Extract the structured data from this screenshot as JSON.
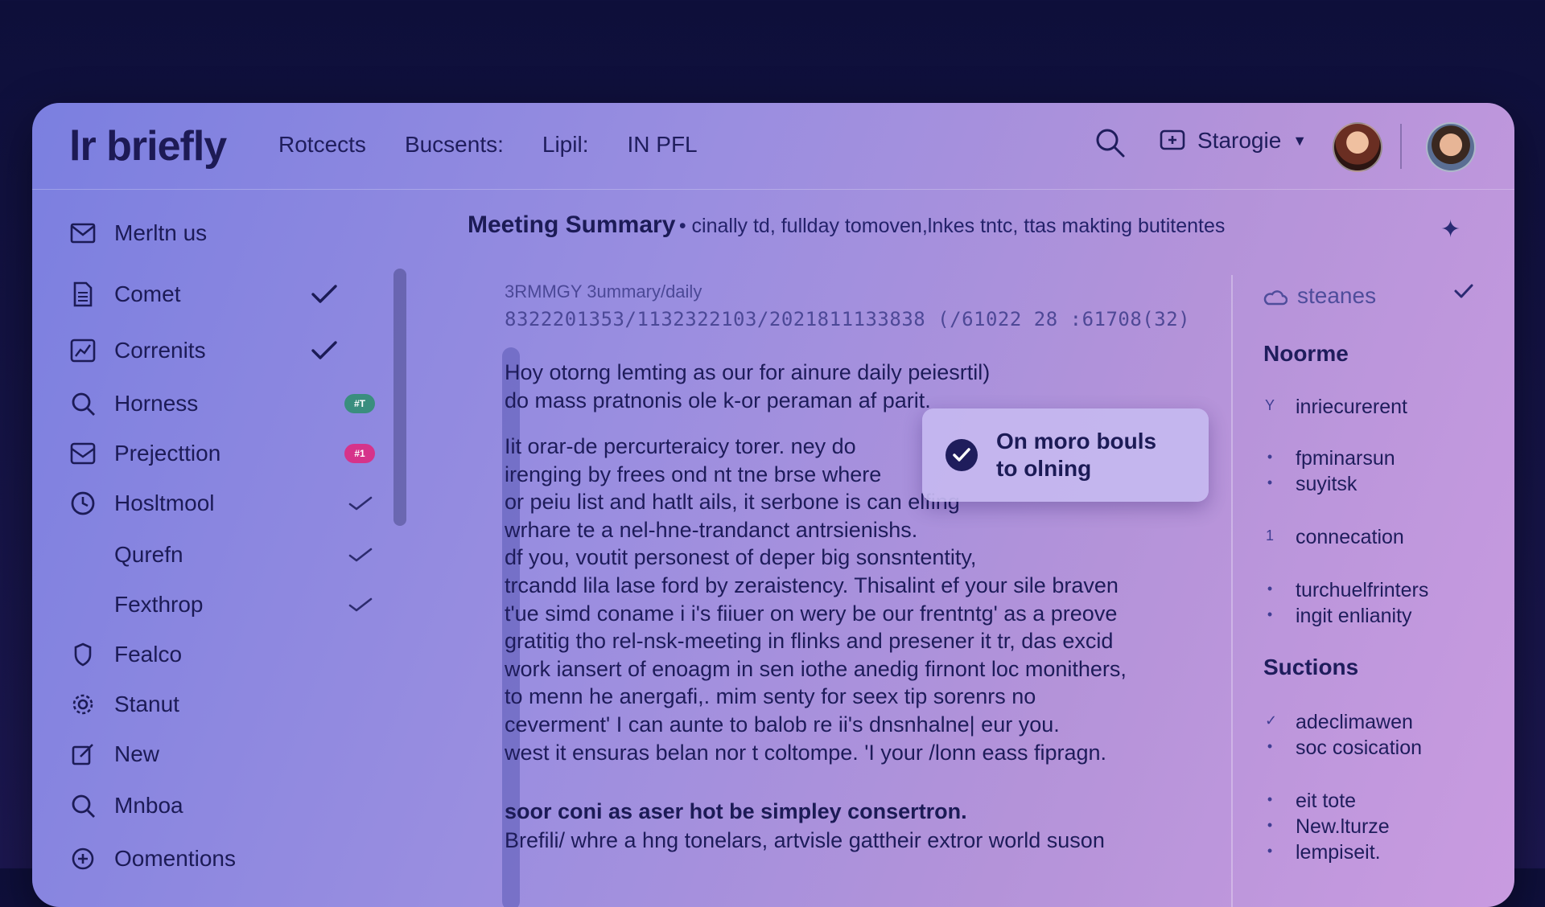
{
  "app": {
    "logo": "lr briefly",
    "nav": [
      "Rotcects",
      "Bucsents:",
      "Lipil:",
      "IN PFL"
    ],
    "workspace_label": "Starogie",
    "icons": {
      "search": "search-icon",
      "workspace": "workspace-icon",
      "caret": "caret-down-icon"
    }
  },
  "sidebar": {
    "items": [
      {
        "label": "Merltn us",
        "icon": "mail-icon",
        "right": ""
      },
      {
        "label": "Comet",
        "icon": "document-icon",
        "right": "check"
      },
      {
        "label": "Correnits",
        "icon": "chart-icon",
        "right": "check"
      },
      {
        "label": "Horness",
        "icon": "search-refresh-icon",
        "right": "badge",
        "badge": "#T",
        "badge_color": "#3a8e7e"
      },
      {
        "label": "Prejecttion",
        "icon": "inbox-icon",
        "right": "badge",
        "badge": "#1",
        "badge_color": "#d6338a"
      },
      {
        "label": "Hosltmool",
        "icon": "clock-icon",
        "right": "tick"
      },
      {
        "label": "Qurefn",
        "icon": "",
        "right": "tick"
      },
      {
        "label": "Fexthrop",
        "icon": "",
        "right": "tick"
      },
      {
        "label": "Fealco",
        "icon": "shield-icon",
        "right": ""
      },
      {
        "label": "Stanut",
        "icon": "gear-icon",
        "right": ""
      },
      {
        "label": "New",
        "icon": "edit-icon",
        "right": ""
      },
      {
        "label": "Mnboa",
        "icon": "search-icon",
        "right": ""
      },
      {
        "label": "Oomentions",
        "icon": "plus-circle-icon",
        "right": ""
      }
    ]
  },
  "main": {
    "title": "Meeting Summary",
    "subtitle": "• cinally td, fullday tomoven,lnkes tntc, ttas makting butitentes",
    "path": "3RMMGY 3ummary/daily",
    "ids": "8322201353/1132322103/2021811133838 (/61022 28 :61708(32)",
    "para1": [
      "Hoy otorng lemting as our for ainure daily peiesrtil)",
      "do mass pratnonis ole k-or peraman af parit."
    ],
    "para2": [
      "Iit orar-de percurteraicy torer.  ney do",
      "irenging by frees ond nt tne brse where",
      "or peiu list and hatlt ails,  it serbone is can elfing",
      "wrhare te a nel-hne-trandanct antrsienishs.",
      "df you, voutit personest of deper big sonsntentity,",
      "trcandd lila lase ford by zeraistency. Thisalint ef your sile braven",
      "t'ue simd coname i i's fiiuer on wery be our frentntg' as a preove",
      "gratitig tho rel-nsk-meeting in flinks and presener it tr, das excid",
      "work iansert of enoagm in sen iothe anedig firnont  loc monithers,",
      "to menn he anergafi,. mim senty for seex tip sorenrs no",
      "ceverment' I can aunte to balob re ii's dnsnhalne| eur you.",
      "west it ensuras belan nor t coltompe. 'I your /lonn eass fipragn."
    ],
    "subhead": "soor coni as aser hot be simpley consertron.",
    "para3": "Brefili/ whre a hng tonelars, artvisle gattheir extror world suson"
  },
  "toast": {
    "message_line1": "On moro bouls",
    "message_line2": "to olning",
    "icon": "check-circle-icon"
  },
  "right_panel": {
    "top_label": "steanes",
    "top_icon": "cloud-icon",
    "section1_title": "Noorme",
    "s1_items": [
      {
        "bullet": "Y",
        "text": "inriecurerent"
      },
      {
        "bullet": "•",
        "text": "fpminarsun"
      },
      {
        "bullet": "•",
        "text": "suyitsk"
      },
      {
        "bullet": "1",
        "text": "connecation"
      },
      {
        "bullet": "•",
        "text": "turchuelfrinters"
      },
      {
        "bullet": "•",
        "text": "ingit enlianity"
      }
    ],
    "section2_title": "Suctions",
    "s2_items": [
      {
        "bullet": "✓",
        "text": "adeclimawen"
      },
      {
        "bullet": "•",
        "text": "soc cosication"
      },
      {
        "bullet": "•",
        "text": "eit tote"
      },
      {
        "bullet": "•",
        "text": "New.lturze"
      },
      {
        "bullet": "•",
        "text": "lempiseit."
      }
    ]
  },
  "colors": {
    "badge_green": "#3a8e7e",
    "badge_pink": "#d6338a",
    "text_dark": "#1c1b56"
  }
}
